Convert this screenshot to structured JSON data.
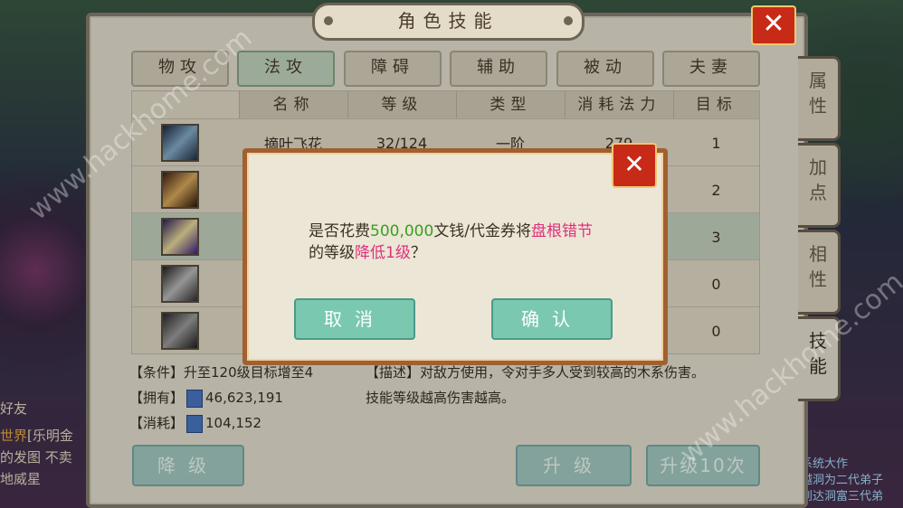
{
  "panel": {
    "title": "角色技能"
  },
  "tabs": [
    "物攻",
    "法攻",
    "障碍",
    "辅助",
    "被动",
    "夫妻"
  ],
  "side_tabs": [
    "属性",
    "加点",
    "相性",
    "技能"
  ],
  "table": {
    "headers": [
      "名称",
      "等级",
      "类型",
      "消耗法力",
      "目标"
    ],
    "rows": [
      {
        "name": "摘叶飞花",
        "level": "32/124",
        "type": "一阶",
        "cost": "279",
        "target": "1"
      },
      {
        "name": "",
        "level": "",
        "type": "",
        "cost": "",
        "target": "2"
      },
      {
        "name": "",
        "level": "",
        "type": "",
        "cost": "",
        "target": "3"
      },
      {
        "name": "",
        "level": "",
        "type": "",
        "cost": "",
        "target": "0"
      },
      {
        "name": "",
        "level": "",
        "type": "",
        "cost": "",
        "target": "0"
      }
    ]
  },
  "info": {
    "condition": "【条件】升至120级目标增至4",
    "own_label": "【拥有】",
    "own_value": "46,623,191",
    "cost_label": "【消耗】",
    "cost_value": "104,152",
    "desc_line1": "【描述】对敌方使用，令对手多人受到较高的木系伤害。",
    "desc_line2": "技能等级越高伤害越高。"
  },
  "buttons": {
    "downgrade": "降级",
    "upgrade": "升级",
    "upgrade10": "升级10次"
  },
  "dialog": {
    "part1": "是否花费",
    "amount": "500,000",
    "part2": "文钱/代金券将",
    "skill": "盘根错节",
    "part3": "的等级",
    "action": "降低1级",
    "part4": "？",
    "cancel": "取消",
    "confirm": "确认"
  },
  "chat": {
    "line1_tag": "世界",
    "line1": "[乐明金",
    "line2": "的发图 不卖",
    "line3": "地威星",
    "friends": "好友"
  },
  "right_chat": {
    "line1": "系统大作",
    "line2": "越洞为二代弟子",
    "line3": "到达洞富三代弟"
  },
  "watermark": "www.hackhome.com",
  "colors": {
    "highlight_green": "#3aa020",
    "highlight_pink": "#e0307a",
    "close_red": "#c82a18"
  }
}
